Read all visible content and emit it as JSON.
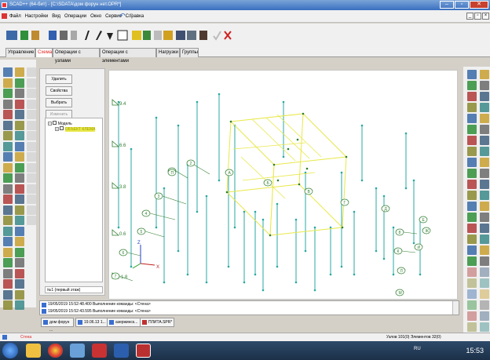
{
  "window": {
    "title": "SCAD++ (64-бит) - [C:\\SDATA\\дом форун нет.OPR*]"
  },
  "menu": [
    "Файл",
    "Настройки",
    "Вид",
    "Операции",
    "Окно",
    "Сервис",
    "Справка"
  ],
  "tabs": [
    {
      "label": "Управление"
    },
    {
      "label": "Схема"
    },
    {
      "label": "Операции с узлами"
    },
    {
      "label": "Операции с элементами"
    },
    {
      "label": "Нагрузки"
    },
    {
      "label": "Группы"
    }
  ],
  "panel": {
    "buttons": [
      {
        "label": "Удалить"
      },
      {
        "label": "Свойства"
      },
      {
        "label": "Выбрать"
      },
      {
        "label": "Изменить"
      }
    ],
    "tree": {
      "root": "Модель",
      "child": "ОБЪЕКТ КЛЕМА"
    },
    "floor": "№1 (первый этаж)"
  },
  "canvas": {
    "level_labels": [
      "9.4",
      "6.6",
      "3.8",
      "0.6",
      "-1.8"
    ],
    "axis_labels": {
      "x": "X",
      "z": "Z"
    },
    "node_labels": [
      "1",
      "2",
      "3",
      "4",
      "5",
      "6",
      "7",
      "8",
      "A",
      "Б",
      "В",
      "Г",
      "Д",
      "Е",
      "Ж",
      "И",
      "К",
      "Л",
      "М",
      "П"
    ]
  },
  "log": {
    "lines": [
      "19/05/2019 15:52:48.400 Выполнение команды: <Стена>",
      "19/05/2019 15:52:43.595 Выполнение команды: <Стена>"
    ]
  },
  "doc_tabs": [
    {
      "label": "дом форун ..."
    },
    {
      "label": "19.06.13 1..."
    },
    {
      "label": "азержинск..."
    },
    {
      "label": "ПЛИТА.SPR*"
    }
  ],
  "status": {
    "left": "Стена",
    "right": "Узлов 101(0) Элементов 32(0)"
  },
  "taskbar": {
    "lang": "RU",
    "time": "15:53"
  },
  "colors": {
    "accent_red": "#e02020",
    "frame_cyan": "#2aa9a0",
    "grid_yellow": "#e8e84a",
    "node_green": "#2f7d2f"
  }
}
